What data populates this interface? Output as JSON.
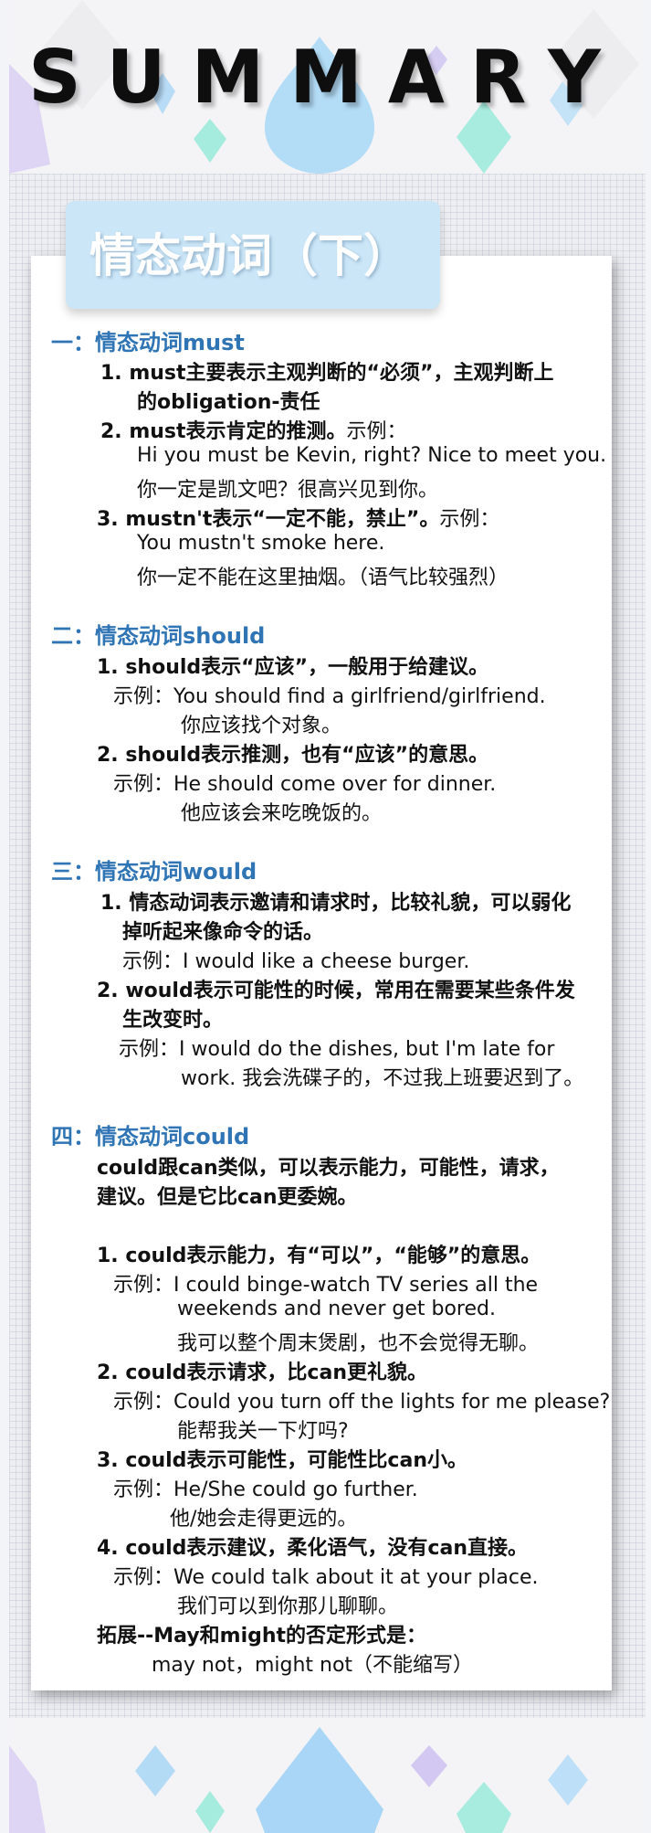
{
  "header": {
    "title": "SUMMARY"
  },
  "card": {
    "tab_title": "情态动词（下）"
  },
  "sec1": {
    "title": "一：情态动词must",
    "p1a": "1. must主要表示主观判断的“必须”，主观判断上",
    "p1b": "的obligation-责任",
    "p2_bold": "2. must表示肯定的推测。",
    "p2_rest": "示例：",
    "p2_ex_en": "Hi you must be Kevin, right? Nice to meet you.",
    "p2_ex_zh": "你一定是凯文吧？很高兴见到你。",
    "p3_bold": "3. mustn't表示“一定不能，禁止”。",
    "p3_rest": "示例：",
    "p3_ex_en": "You mustn't smoke here.",
    "p3_ex_zh": "你一定不能在这里抽烟。（语气比较强烈）"
  },
  "sec2": {
    "title": "二：情态动词should",
    "p1": "1. should表示“应该”，一般用于给建议。",
    "p1_ex_label": "示例：",
    "p1_ex_en": "You should find a girlfriend/girlfriend.",
    "p1_ex_zh": "你应该找个对象。",
    "p2": "2. should表示推测，也有“应该”的意思。",
    "p2_ex_label": "示例：",
    "p2_ex_en": "He should come over for dinner.",
    "p2_ex_zh": "他应该会来吃晚饭的。"
  },
  "sec3": {
    "title": "三：情态动词would",
    "p1a": "1. 情态动词表示邀请和请求时，比较礼貌，可以弱化",
    "p1b": "掉听起来像命令的话。",
    "p1_ex_label": "示例：",
    "p1_ex_en": "I would like a cheese burger.",
    "p2a": "2. would表示可能性的时候，常用在需要某些条件发",
    "p2b": "生改变时。",
    "p2_ex_label": "示例：",
    "p2_ex_a": "I would do the dishes, but I'm late for",
    "p2_ex_b": "work. 我会洗碟子的，不过我上班要迟到了。"
  },
  "sec4": {
    "title": "四：情态动词could",
    "intro_a": "could跟can类似，可以表示能力，可能性，请求，",
    "intro_b": "建议。但是它比can更委婉。",
    "p1": "1. could表示能力，有“可以”，“能够”的意思。",
    "p1_ex_label": "示例：",
    "p1_ex_a": "I could binge-watch TV series all the",
    "p1_ex_b": "weekends  and never get bored.",
    "p1_ex_zh": "我可以整个周末煲剧，也不会觉得无聊。",
    "p2": "2. could表示请求，比can更礼貌。",
    "p2_ex_label": "示例：",
    "p2_ex_en": "Could you turn off the lights for me please?",
    "p2_ex_zh": "能帮我关一下灯吗?",
    "p3": "3. could表示可能性，可能性比can小。",
    "p3_ex_label": "示例：",
    "p3_ex_en": "He/She could go further.",
    "p3_ex_zh": "他/她会走得更远的。",
    "p4": "4. could表示建议，柔化语气，没有can直接。",
    "p4_ex_label": "示例：",
    "p4_ex_en": "We could talk about it at your place.",
    "p4_ex_zh": "我们可以到你那儿聊聊。",
    "ext_title": "拓展--May和might的否定形式是：",
    "ext_body": "may not，might not（不能缩写）"
  },
  "colors": {
    "heading": "#2f74b5",
    "tab": "#cbe6f7",
    "text": "#111111"
  }
}
